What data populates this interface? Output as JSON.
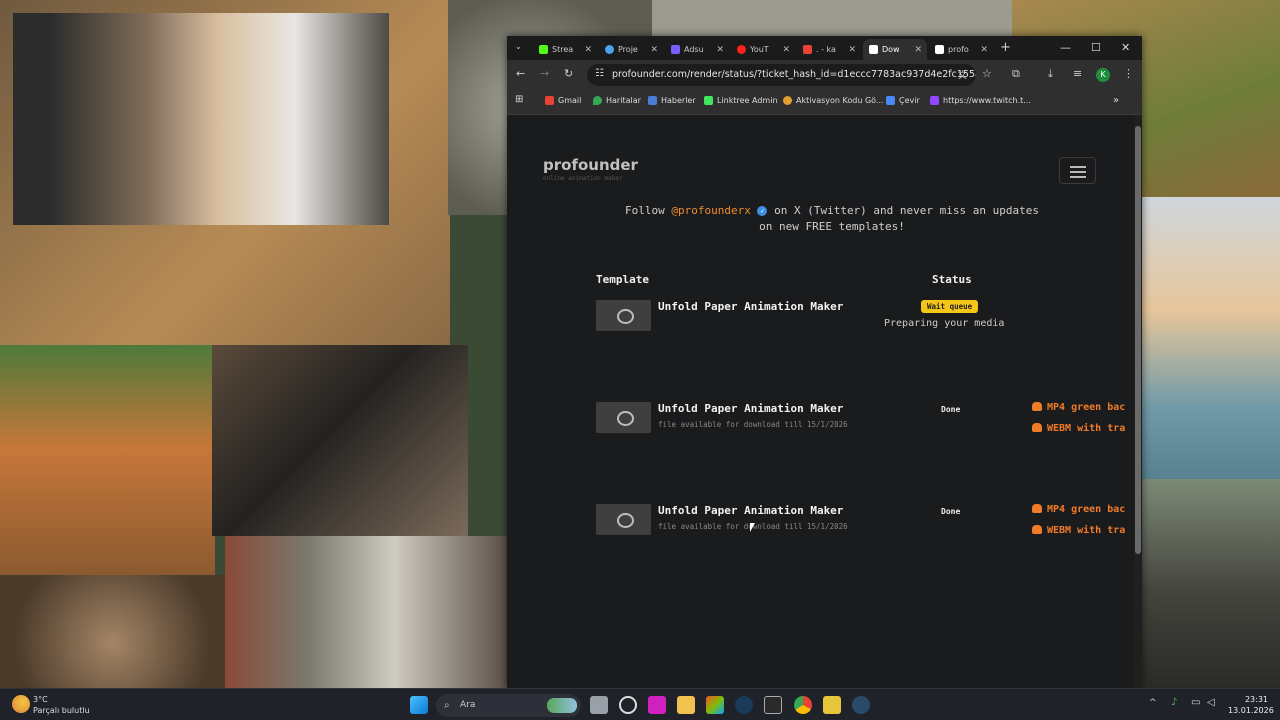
{
  "browser": {
    "tabs": [
      {
        "label": "Strea",
        "color": "#53fc18"
      },
      {
        "label": "Proje",
        "color": "#4aa3f0"
      },
      {
        "label": "Adsu",
        "color": "#7a5cff"
      },
      {
        "label": "YouT",
        "color": "#ff2020"
      },
      {
        "label": ". - ka",
        "color": "#ea4335"
      },
      {
        "label": "Dow",
        "color": "#ffffff"
      },
      {
        "label": "profo",
        "color": "#ffffff"
      }
    ],
    "url": "profounder.com/render/status/?ticket_hash_id=d1eccc7783ac937d4e2fc155a41a...",
    "profile_initial": "K",
    "bookmarks": [
      {
        "label": "Gmail",
        "color": "#ea4335"
      },
      {
        "label": "Haritalar",
        "color": "#34a853"
      },
      {
        "label": "Haberler",
        "color": "#4a7dd8"
      },
      {
        "label": "Linktree Admin",
        "color": "#43e660"
      },
      {
        "label": "Aktivasyon Kodu Gö...",
        "color": "#e0a030"
      },
      {
        "label": "Çevir",
        "color": "#4a8af4"
      },
      {
        "label": "https://www.twitch.t...",
        "color": "#9146ff"
      }
    ]
  },
  "site": {
    "logo": "profounder",
    "tagline": "online animation maker",
    "follow_pre": "Follow ",
    "follow_handle": "@profounderx",
    "follow_post1": " on X (Twitter) and never miss an updates",
    "follow_post2": "on new FREE templates!",
    "col_template": "Template",
    "col_status": "Status",
    "rows": [
      {
        "name": "Unfold Paper Animation Maker",
        "badge": "Wait queue",
        "status_text": "Preparing your media"
      },
      {
        "name": "Unfold Paper Animation Maker",
        "sub": "file available for download till 15/1/2026",
        "status": "Done",
        "dl1": "MP4 green bac",
        "dl2": "WEBM with tra"
      },
      {
        "name": "Unfold Paper Animation Maker",
        "sub": "file available for download till 15/1/2026",
        "status": "Done",
        "dl1": "MP4 green bac",
        "dl2": "WEBM with tra"
      }
    ]
  },
  "taskbar": {
    "temp": "3°C",
    "weather": "Parçalı bulutlu",
    "search": "Ara",
    "time": "23:31",
    "date": "13.01.2026"
  }
}
